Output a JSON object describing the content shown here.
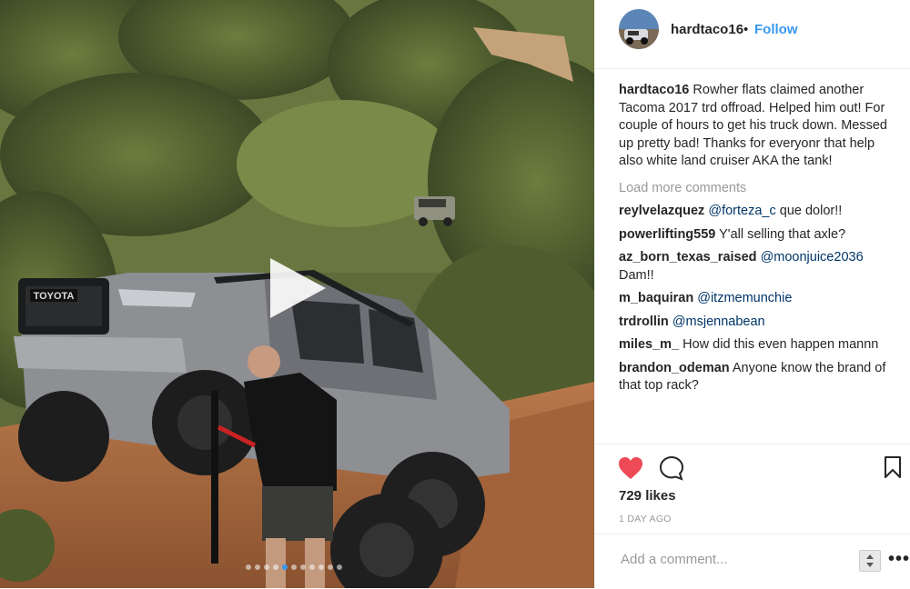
{
  "header": {
    "username": "hardtaco16",
    "separator": "•",
    "follow_label": "Follow"
  },
  "caption": {
    "username": "hardtaco16",
    "text": "Rowher flats claimed another Tacoma 2017 trd offroad. Helped him out! For couple of hours to get his truck down. Messed up pretty bad! Thanks for everyonr that help also white land cruiser AKA the tank!"
  },
  "load_more": "Load more comments",
  "comments": [
    {
      "user": "reylvelazquez",
      "mention": "@forteza_c",
      "text": "que dolor!!"
    },
    {
      "user": "powerlifting559",
      "mention": "",
      "text": "Y'all selling that axle?"
    },
    {
      "user": "az_born_texas_raised",
      "mention": "@moonjuice2036",
      "text": "Dam!!"
    },
    {
      "user": "m_baquiran",
      "mention": "@itzmemunchie",
      "text": ""
    },
    {
      "user": "trdrollin",
      "mention": "@msjennabean",
      "text": ""
    },
    {
      "user": "miles_m_",
      "mention": "",
      "text": "How did this even happen mannn"
    },
    {
      "user": "brandon_odeman",
      "mention": "",
      "text": "Anyone know the brand of that top rack?"
    }
  ],
  "likes": "729 likes",
  "posted_ago": "1 DAY AGO",
  "add_comment_placeholder": "Add a comment...",
  "more_label": "•••",
  "media": {
    "carousel_count": 11,
    "carousel_active_index": 4,
    "grille_text": "TOYOTA"
  },
  "colors": {
    "accent": "#3897f0",
    "like": "#ed4956",
    "mention": "#003569",
    "muted": "#999999"
  },
  "icons": [
    "play-icon",
    "heart-icon",
    "comment-icon",
    "bookmark-icon",
    "stepper-icon",
    "more-icon"
  ]
}
